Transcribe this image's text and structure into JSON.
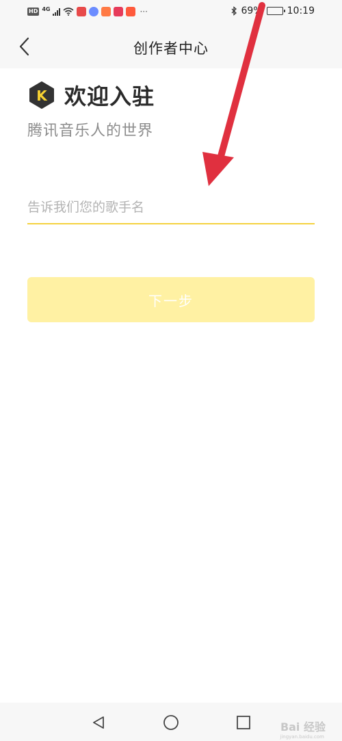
{
  "status_bar": {
    "hd": "HD",
    "network": "4G",
    "more": "···",
    "battery_text": "69%",
    "battery_level": 0.69,
    "time": "10:19",
    "app_icon_colors": [
      "#e84a4a",
      "#6b8cff",
      "#ff7a45",
      "#e63b5a",
      "#ff5a3c"
    ]
  },
  "nav": {
    "title": "创作者中心",
    "back_icon": "chevron-left-icon"
  },
  "welcome": {
    "logo_letter": "K",
    "title": "欢迎入驻",
    "subtitle": "腾讯音乐人的世界"
  },
  "form": {
    "name_value": "",
    "name_placeholder": "告诉我们您的歌手名",
    "next_label": "下一步"
  },
  "colors": {
    "accent": "#f5d23e",
    "button_disabled": "#fff1a3",
    "annotation_arrow": "#e0303f"
  },
  "system_nav": {
    "back": "triangle-back-icon",
    "home": "circle-home-icon",
    "recents": "square-recents-icon"
  },
  "watermark": {
    "text": "Bai 经验",
    "sub": "jingyan.baidu.com"
  }
}
